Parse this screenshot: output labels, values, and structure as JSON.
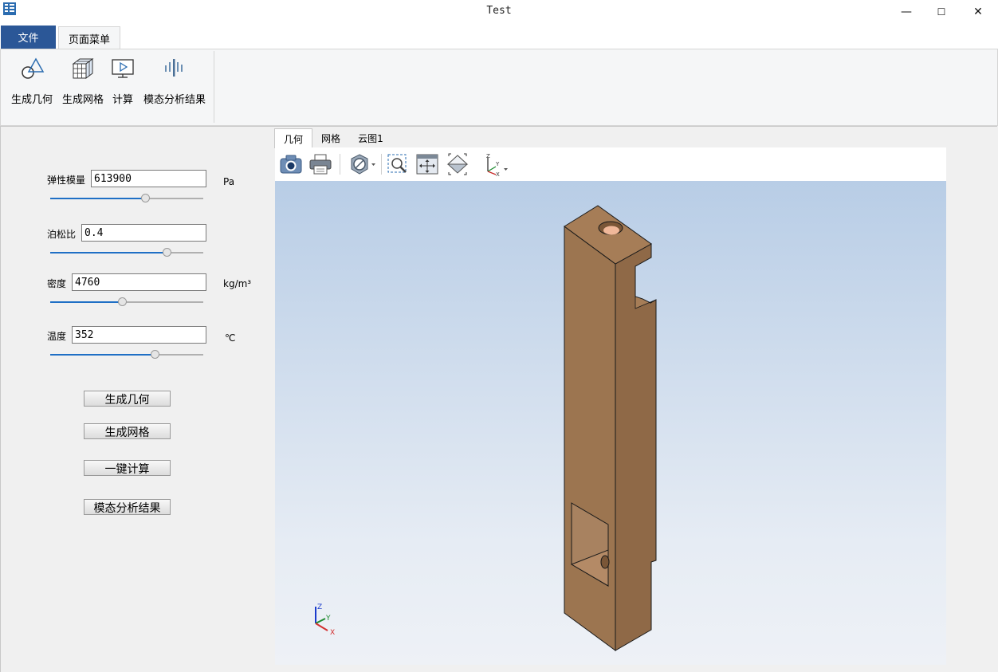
{
  "window": {
    "title": "Test",
    "minimize_glyph": "—",
    "maximize_glyph": "☐",
    "close_glyph": "✕"
  },
  "tabs": {
    "file": "文件",
    "page_menu": "页面菜单"
  },
  "ribbon": {
    "items": [
      {
        "label": "生成几何",
        "icon": "geometry-icon"
      },
      {
        "label": "生成网格",
        "icon": "mesh-icon"
      },
      {
        "label": "计算",
        "icon": "compute-icon"
      },
      {
        "label": "模态分析结果",
        "icon": "modal-analysis-icon"
      }
    ]
  },
  "params": [
    {
      "label": "弹性模量",
      "value": "613900",
      "unit": "Pa",
      "slider_fraction": 0.62
    },
    {
      "label": "泊松比",
      "value": "0.4",
      "unit": "",
      "slider_fraction": 0.76
    },
    {
      "label": "密度",
      "value": "4760",
      "unit": "kg/m³",
      "slider_fraction": 0.47
    },
    {
      "label": "温度",
      "value": "352",
      "unit": "℃",
      "slider_fraction": 0.68
    }
  ],
  "buttons": {
    "gen_geometry": "生成几何",
    "gen_mesh": "生成网格",
    "one_click_compute": "一键计算",
    "modal_results": "模态分析结果"
  },
  "viewer": {
    "tabs": [
      "几何",
      "网格",
      "云图1"
    ],
    "active_tab": "几何",
    "toolbar": [
      "camera-icon",
      "print-icon",
      "display-mode-icon",
      "zoom-box-icon",
      "fit-all-icon",
      "view-cube-icon",
      "axis-orientation-icon"
    ],
    "axis_triad": {
      "x": "X",
      "y": "Y",
      "z": "Z"
    }
  },
  "colors": {
    "accent": "#2b5797",
    "model": "#9c7550",
    "slider": "#1f6fc5"
  }
}
